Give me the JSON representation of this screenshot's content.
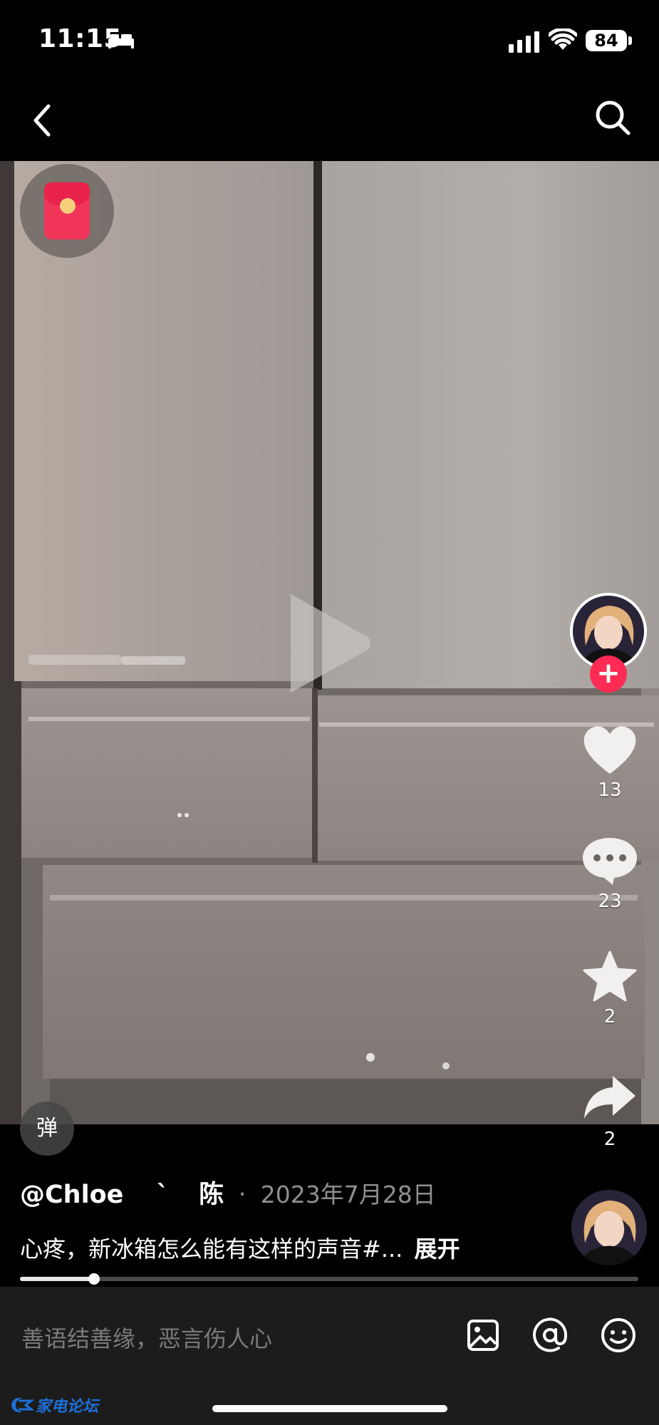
{
  "status_bar": {
    "time": "11:15",
    "battery": "84"
  },
  "video": {
    "progress": 0.12
  },
  "side_rail": {
    "like_count": "13",
    "comment_count": "23",
    "favorite_count": "2",
    "share_count": "2"
  },
  "author": {
    "handle": "@Chloe",
    "mark": "ˋ",
    "name_suffix": "陈",
    "separator": "·",
    "date": "2023年7月28日"
  },
  "caption": {
    "text": "心疼，新冰箱怎么能有这样的声音#...",
    "expand_label": "展开"
  },
  "danmu_label": "弹",
  "comment_bar": {
    "placeholder": "善语结善缘，恶言伤人心"
  },
  "colors": {
    "accent": "#fe2c55",
    "bar_bg": "#1c1c1c",
    "watermark": "#1e6fd9"
  },
  "watermark_text": "家电论坛",
  "icons": [
    "back-icon",
    "search-icon",
    "red-packet-icon",
    "play-icon",
    "heart-icon",
    "comment-icon",
    "star-icon",
    "share-icon",
    "image-icon",
    "mention-icon",
    "emoji-icon",
    "bed-icon",
    "signal-icon",
    "wifi-icon"
  ]
}
